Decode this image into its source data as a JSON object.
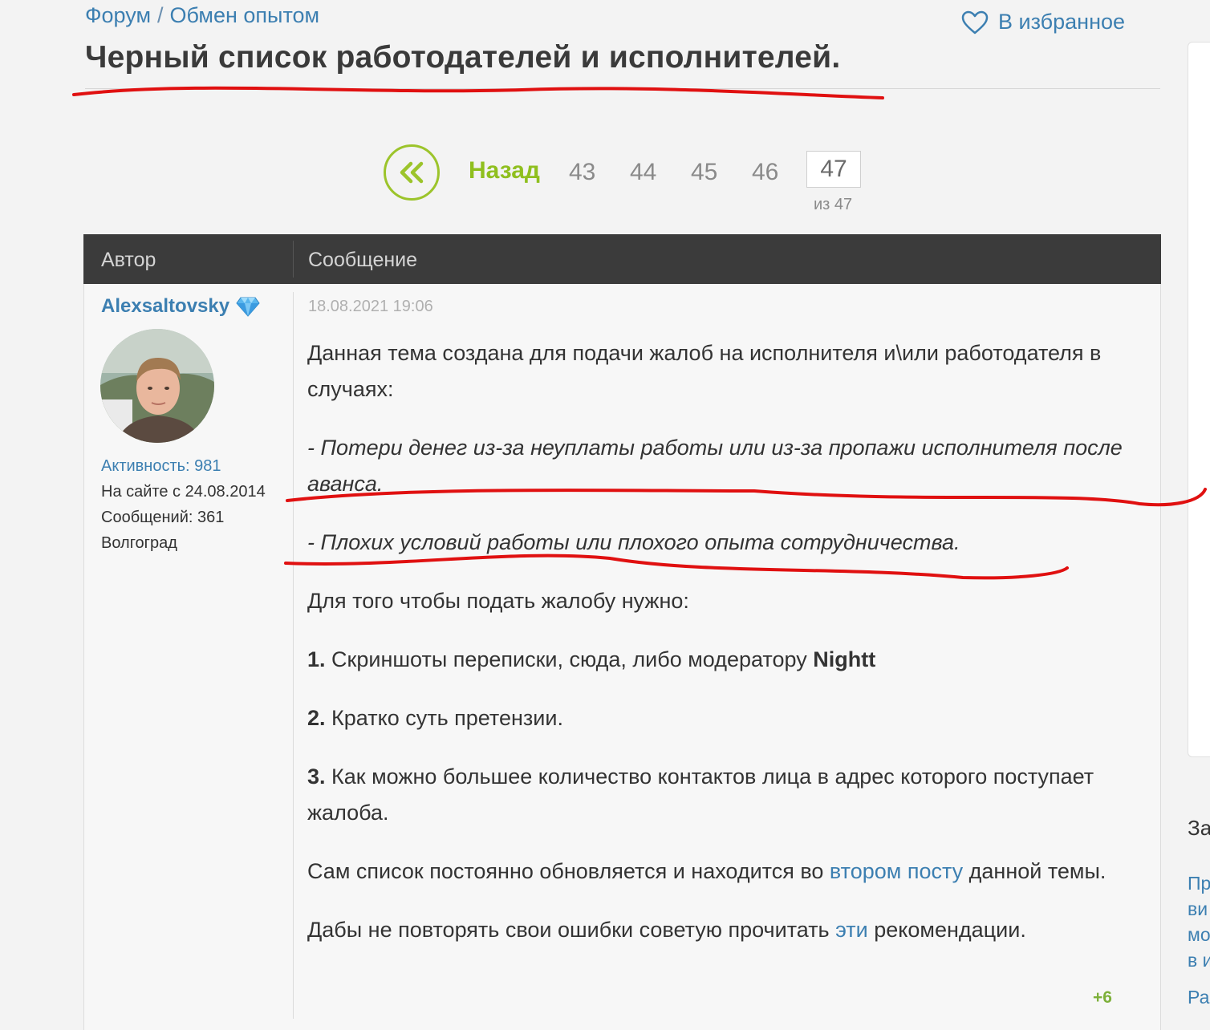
{
  "breadcrumb": {
    "forum": "Форум",
    "separator": "/",
    "section": "Обмен опытом"
  },
  "favorite_label": "В избранное",
  "thread_title": "Черный список работодателей и исполнителей.",
  "pagination": {
    "back_label": "Назад",
    "pages": [
      "43",
      "44",
      "45",
      "46"
    ],
    "current": "47",
    "total_label": "из 47"
  },
  "table": {
    "author_header": "Автор",
    "message_header": "Сообщение"
  },
  "author": {
    "name": "Alexsaltovsky",
    "activity": "Активность: 981",
    "since": "На сайте с 24.08.2014",
    "messages": "Сообщений: 361",
    "city": "Волгоград"
  },
  "post": {
    "date": "18.08.2021 19:06",
    "p1": "Данная тема создана для подачи жалоб на исполнителя и\\или работодателя в случаях:",
    "p2": "- Потери денег из-за неуплаты работы или из-за пропажи исполнителя после аванса.",
    "p3": "- Плохих условий работы или плохого опыта сотрудничества.",
    "p4": "Для того чтобы подать жалобу нужно:",
    "item1_num": "1.",
    "item1_text": "Скриншоты переписки, сюда, либо модератору ",
    "item1_bold": "Nightt",
    "item2_num": "2.",
    "item2_text": "Кратко суть претензии.",
    "item3_num": "3.",
    "item3_text": "Как можно большее количество контактов лица в адрес которого поступает жалоба.",
    "p5_a": "Сам список постоянно обновляется и находится во ",
    "p5_link": "втором посту",
    "p5_b": " данной темы.",
    "p6_a": "Дабы не повторять свои ошибки советую прочитать ",
    "p6_link": "эти",
    "p6_b": " рекомендации.",
    "rating": "+6"
  },
  "sidebar_fragments": {
    "heading": "За",
    "lines": [
      "Пр",
      "ви",
      "мо",
      "в и",
      "Ра"
    ]
  },
  "colors": {
    "link": "#3c7fb1",
    "accent_green": "#8fbf1e",
    "header_dark": "#3b3b3b",
    "annotation_red": "#e01010"
  }
}
